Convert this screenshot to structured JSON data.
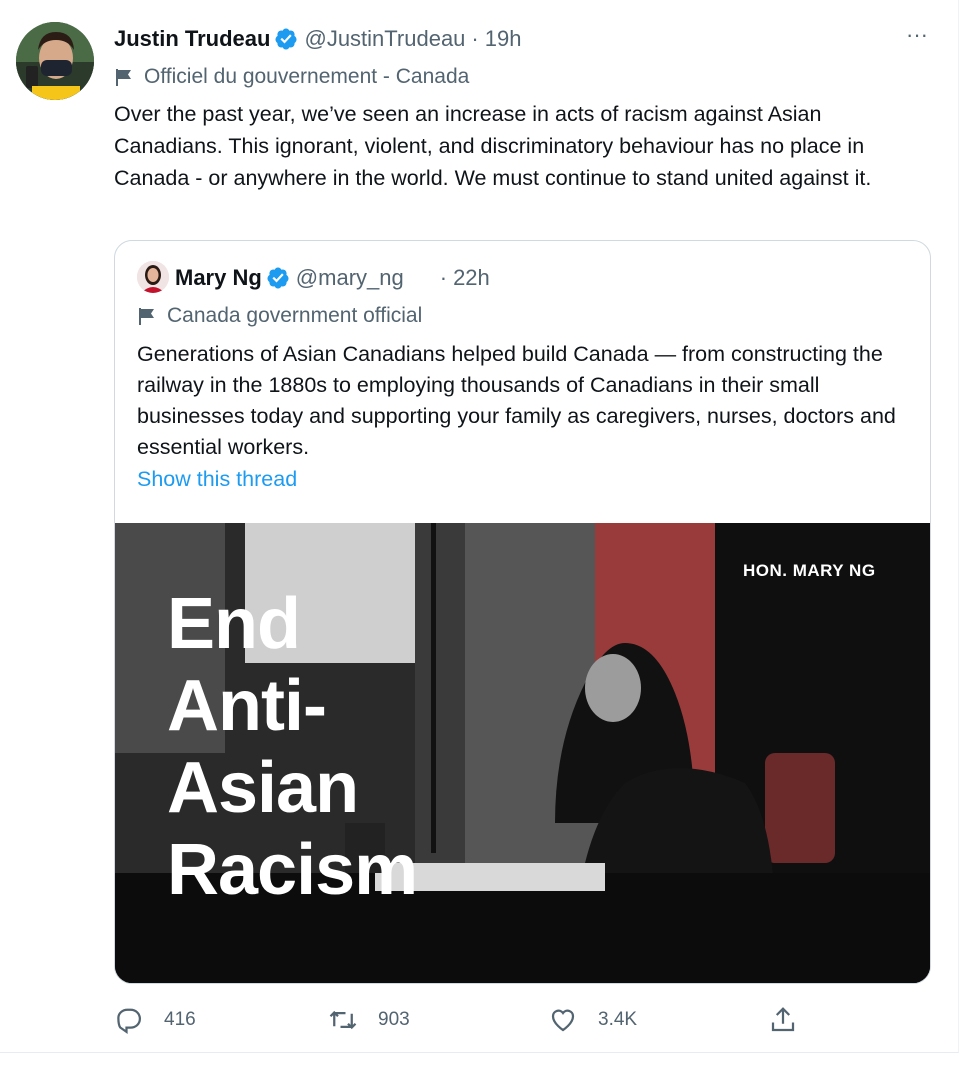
{
  "tweet": {
    "author_name": "Justin Trudeau",
    "handle": "@JustinTrudeau",
    "separator": "·",
    "time": "19h",
    "gov_label": "Officiel du gouvernement - Canada",
    "text": "Over the past year, we’ve seen an increase in acts of racism against Asian Canadians. This ignorant, violent, and discriminatory behaviour has no place in Canada - or anywhere in the world. We must continue to stand united against it.",
    "more_label": "···"
  },
  "quote": {
    "author_name": "Mary Ng",
    "handle": "@mary_ng",
    "separator": "·",
    "time": "22h",
    "gov_label": "Canada government official",
    "text": "Generations of Asian Canadians helped build Canada — from constructing the railway in the 1880s to employing thousands of Canadians in their small businesses today and supporting your family as caregivers, nurses, doctors and essential workers.",
    "show_thread": "Show this thread",
    "image": {
      "title_lines": [
        "End",
        "Anti-",
        "Asian",
        "Racism"
      ],
      "name_label": "HON. MARY NG"
    }
  },
  "actions": {
    "reply_count": "416",
    "retweet_count": "903",
    "like_count": "3.4K"
  },
  "colors": {
    "verified": "#1d9bf0",
    "link": "#1d9bf0",
    "muted": "#536471",
    "flag_red": "#c8242d"
  },
  "icons": {
    "verified": "verified-badge-icon",
    "gov": "flag-icon",
    "reply": "reply-icon",
    "retweet": "retweet-icon",
    "like": "heart-icon",
    "share": "share-icon",
    "more": "more-icon"
  }
}
